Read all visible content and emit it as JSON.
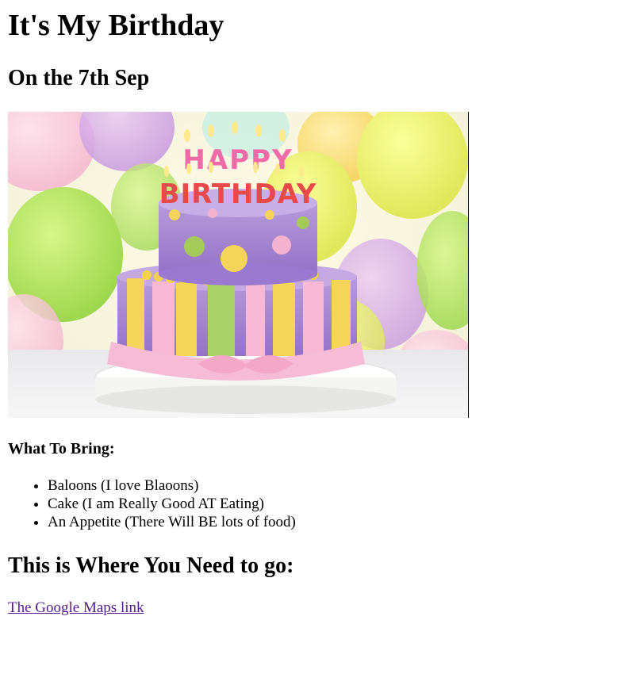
{
  "heading": "It's My Birthday",
  "date_heading": "On the 7th Sep",
  "image": {
    "description_icon": "birthday-cake-image",
    "candle_letters_top": "HAPPY",
    "candle_letters_bottom": "BIRTHDAY"
  },
  "bring_heading": "What To Bring:",
  "bring_items": [
    "Baloons (I love Blaoons)",
    "Cake (I am Really Good AT Eating)",
    "An Appetite (There Will BE lots of food)"
  ],
  "where_heading": "This is Where You Need to go:",
  "maps_link": "The Google Maps link",
  "colors": {
    "visited_link": "#551a8b"
  }
}
